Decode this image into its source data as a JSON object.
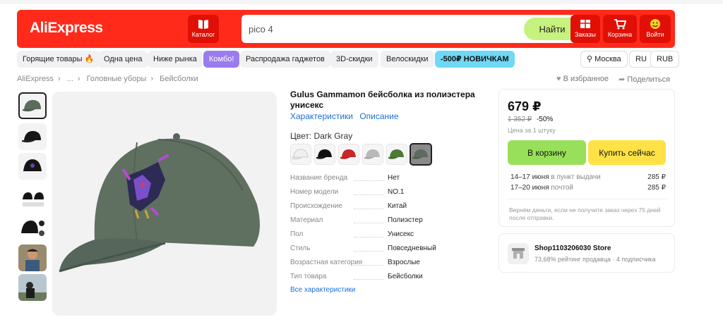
{
  "header": {
    "logo": "AliExpress",
    "catalog_label": "Каталог",
    "search_value": "pico 4",
    "search_button": "Найти",
    "orders_label": "Заказы",
    "cart_label": "Корзина",
    "login_label": "Войти",
    "brand_color": "#ff2a1a"
  },
  "categories": [
    "Горящие товары 🔥",
    "Одна цена",
    "Ниже рынка",
    "Комбо!",
    "Распродажа гаджетов",
    "3D-скидки",
    "Велоскидки",
    "-500₽ НОВИЧКАМ"
  ],
  "locale": {
    "city": "Москва",
    "lang": "RU",
    "currency": "RUB"
  },
  "breadcrumb": [
    "AliExpress",
    "...",
    "Головные уборы",
    "Бейсболки"
  ],
  "actions": {
    "favorite": "В избранное",
    "share": "Поделиться"
  },
  "product": {
    "title": "Gulus Gammamon бейсболка из полиэстера унисекс",
    "link_specs": "Характеристики",
    "link_desc": "Описание",
    "color_label": "Цвет: Dark Gray",
    "swatch_colors": [
      "#f0f0f0",
      "#111111",
      "#c8262b",
      "#b9b9b9",
      "#4e7a38",
      "#5d6a5e"
    ],
    "specs": [
      {
        "key": "Название бренда",
        "value": "Нет"
      },
      {
        "key": "Номер модели",
        "value": "NO.1"
      },
      {
        "key": "Происхождение",
        "value": "Китай"
      },
      {
        "key": "Материал",
        "value": "Полиэстер"
      },
      {
        "key": "Пол",
        "value": "Унисекс"
      },
      {
        "key": "Стиль",
        "value": "Повседневный"
      },
      {
        "key": "Возрастная категория",
        "value": "Взрослые"
      },
      {
        "key": "Тип товара",
        "value": "Бейсболки"
      }
    ],
    "all_specs_link": "Все характеристики"
  },
  "buy": {
    "price": "679 ₽",
    "old_price": "1 352 ₽",
    "discount": "-50%",
    "unit_note": "Цена за 1 штуку",
    "add_to_cart": "В корзину",
    "buy_now": "Купить сейчас",
    "shipping": [
      {
        "dates": "14–17 июня",
        "method": "в пункт выдачи",
        "cost": "285 ₽"
      },
      {
        "dates": "17–20 июня",
        "method": "почтой",
        "cost": "285 ₽"
      }
    ],
    "guarantee": "Вернём деньги, если не получите заказ через 75 дней после отправки."
  },
  "store": {
    "name": "Shop1103206030 Store",
    "meta": "73,68% рейтинг продавца · 4 подписчика"
  }
}
